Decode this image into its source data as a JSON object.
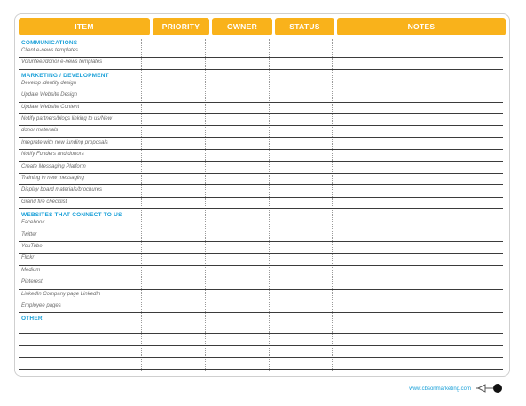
{
  "header": {
    "item": "ITEM",
    "priority": "PRIORITY",
    "owner": "OWNER",
    "status": "STATUS",
    "notes": "NOTES"
  },
  "sections": [
    {
      "title": "COMMUNICATIONS",
      "items": [
        "Client e-news templates",
        "Volunteer/donor e-news templates"
      ]
    },
    {
      "title": "MARKETING / DEVELOPMENT",
      "items": [
        "Develop identity design",
        "Update Website Design",
        "Update Website Content",
        "Notify partners/blogs linking to us/New",
        "donor materials",
        "Integrate with new funding proposals",
        "Notify Funders and donors",
        "Create Messaging Platform",
        "Training in new messaging",
        "Display board materials/brochures",
        "Grand fire checklist"
      ]
    },
    {
      "title": "WEBSITES THAT CONNECT TO US",
      "items": [
        "Facebook",
        "Twitter",
        "YouTube",
        "Flickr",
        "Medium",
        "Pinterest",
        "LinkedIn Company page LinkedIn",
        "Employee pages"
      ]
    },
    {
      "title": "OTHER",
      "items": [
        "",
        "",
        "",
        ""
      ]
    }
  ],
  "footer": {
    "website": "www.cbsonmarketing.com",
    "logo_icon": "megaphone-icon"
  },
  "colors": {
    "header_bg": "#f9b21b",
    "section_title": "#1aa0d8",
    "row_line": "#3b3b3b"
  }
}
